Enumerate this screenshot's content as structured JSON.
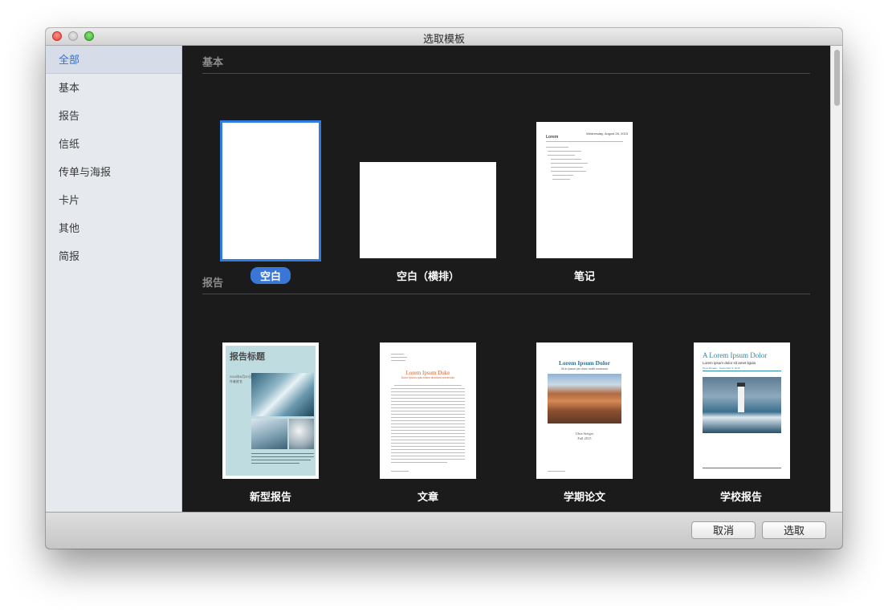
{
  "window": {
    "title": "选取模板"
  },
  "sidebar": {
    "items": [
      {
        "label": "全部",
        "selected": true
      },
      {
        "label": "基本",
        "selected": false
      },
      {
        "label": "报告",
        "selected": false
      },
      {
        "label": "信纸",
        "selected": false
      },
      {
        "label": "传单与海报",
        "selected": false
      },
      {
        "label": "卡片",
        "selected": false
      },
      {
        "label": "其他",
        "selected": false
      },
      {
        "label": "简报",
        "selected": false
      }
    ]
  },
  "sections": [
    {
      "title": "基本",
      "templates": [
        {
          "label": "空白",
          "selected": true
        },
        {
          "label": "空白（横排）",
          "selected": false
        },
        {
          "label": "笔记",
          "selected": false
        }
      ]
    },
    {
      "title": "报告",
      "templates": [
        {
          "label": "新型报告",
          "selected": false
        },
        {
          "label": "文章",
          "selected": false
        },
        {
          "label": "学期论文",
          "selected": false
        },
        {
          "label": "学校报告",
          "selected": false
        }
      ]
    }
  ],
  "thumbnails": {
    "notes": {
      "heading": "Lorem",
      "date": "Wednesday, August 26, 2015"
    },
    "new_report": {
      "title": "报告标题",
      "subtitle": "2016年6月20日\n作者姓名"
    },
    "article": {
      "title": "Lorem Ipsum Duke",
      "subtitle": "Dolor Ipsum quis totam tincidunt commodo"
    },
    "term_paper": {
      "title": "Lorem Ipsum Dolor",
      "subtitle": "Sit in Ipsum per dolor mollit commodo",
      "author": "Ulna Steiger",
      "date": "Fall 2015"
    },
    "school_report": {
      "title": "A Lorem Ipsum Dolor",
      "subtitle": "Lorem ipsum dolor sit amet ligula",
      "byline": "Tome Bonaku · September 9, 2015"
    }
  },
  "footer": {
    "cancel_label": "取消",
    "choose_label": "选取"
  },
  "colors": {
    "accent": "#3a76d6",
    "content_bg": "#1b1b1b",
    "sidebar_bg": "#e6e9ee",
    "article_title": "#d4612c",
    "report_title_teal": "#2a8aa8"
  }
}
